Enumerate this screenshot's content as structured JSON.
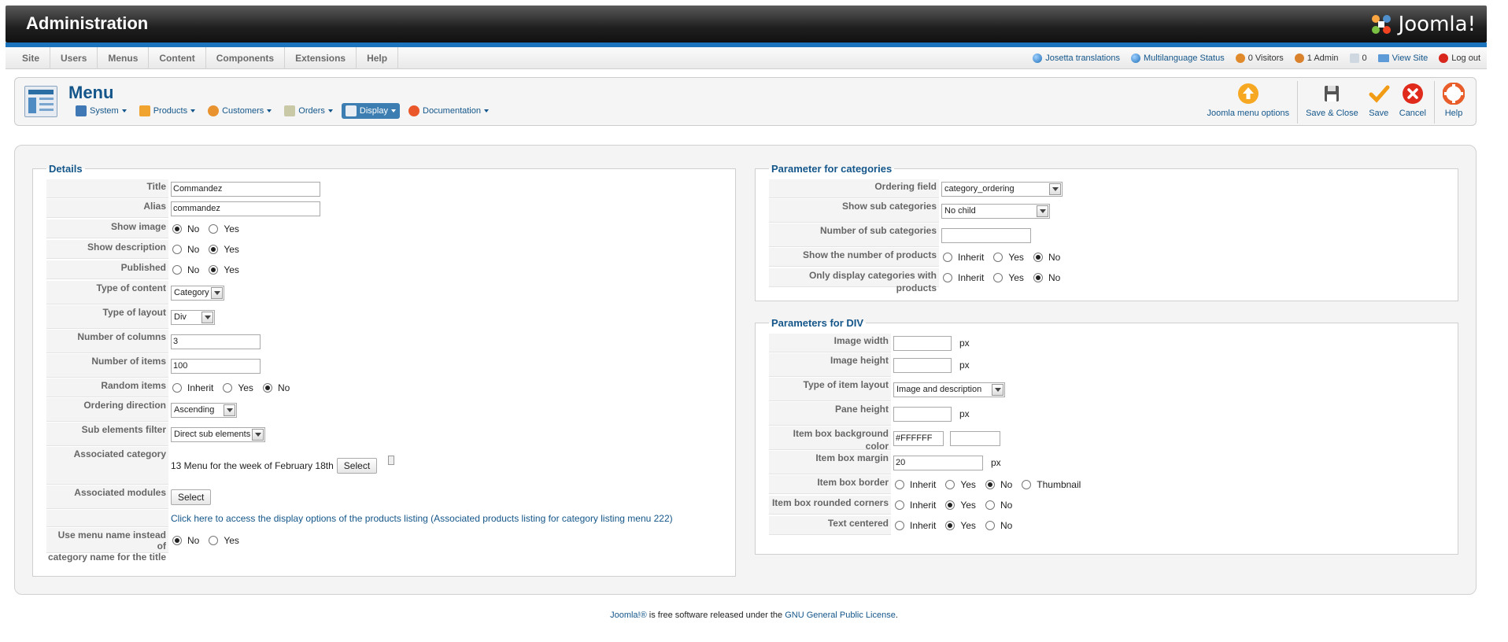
{
  "header": {
    "title": "Administration",
    "brand": "Joomla!"
  },
  "mainmenu": [
    "Site",
    "Users",
    "Menus",
    "Content",
    "Components",
    "Extensions",
    "Help"
  ],
  "status": [
    {
      "label": "Josetta translations",
      "icon": "globe-icon",
      "link": true
    },
    {
      "label": "Multilanguage Status",
      "icon": "globe-icon",
      "link": true
    },
    {
      "label": "0 Visitors",
      "icon": "users-icon",
      "link": false
    },
    {
      "label": "1 Admin",
      "icon": "user-icon",
      "link": false
    },
    {
      "label": "0",
      "icon": "message-icon",
      "link": false
    },
    {
      "label": "View Site",
      "icon": "monitor-icon",
      "link": true
    },
    {
      "label": "Log out",
      "icon": "logout-icon",
      "link": false
    }
  ],
  "toolbar": {
    "title": "Menu",
    "submenu": [
      "System",
      "Products",
      "Customers",
      "Orders",
      "Display",
      "Documentation"
    ],
    "actions": {
      "joomla_options": "Joomla menu options",
      "save_close": "Save & Close",
      "save": "Save",
      "cancel": "Cancel",
      "help": "Help"
    }
  },
  "details": {
    "legend": "Details",
    "labels": {
      "title": "Title",
      "alias": "Alias",
      "show_image": "Show image",
      "show_description": "Show description",
      "published": "Published",
      "type_content": "Type of content",
      "type_layout": "Type of layout",
      "num_columns": "Number of columns",
      "num_items": "Number of items",
      "random_items": "Random items",
      "ordering_direction": "Ordering direction",
      "sub_filter": "Sub elements filter",
      "assoc_category": "Associated category",
      "assoc_modules": "Associated modules",
      "use_menu_name_1": "Use menu name instead of",
      "use_menu_name_2": "category name for the title"
    },
    "values": {
      "title": "Commandez",
      "alias": "commandez",
      "type_content": "Category",
      "type_layout": "Div",
      "num_columns": "3",
      "num_items": "100",
      "ordering_direction": "Ascending",
      "sub_filter": "Direct sub elements",
      "assoc_category": "13 Menu for the week of February 18th",
      "select": "Select",
      "link": "Click here to access the display options of the products listing (Associated products listing for category listing menu 222)"
    },
    "options": {
      "no": "No",
      "yes": "Yes",
      "inherit": "Inherit"
    }
  },
  "categories": {
    "legend": "Parameter for categories",
    "labels": {
      "ordering_field": "Ordering field",
      "show_sub": "Show sub categories",
      "num_sub": "Number of sub categories",
      "show_num_products": "Show the number of products",
      "only_display": "Only display categories with products"
    },
    "values": {
      "ordering_field": "category_ordering",
      "show_sub": "No child",
      "num_sub": ""
    }
  },
  "div": {
    "legend": "Parameters for DIV",
    "labels": {
      "image_width": "Image width",
      "image_height": "Image height",
      "item_layout": "Type of item layout",
      "pane_height": "Pane height",
      "bg_color": "Item box background color",
      "margin": "Item box margin",
      "border": "Item box border",
      "rounded": "Item box rounded corners",
      "centered": "Text centered"
    },
    "values": {
      "px": "px",
      "item_layout": "Image and description",
      "bg_color": "#FFFFFF",
      "margin": "20",
      "thumbnail": "Thumbnail"
    }
  },
  "footer": {
    "joomla": "Joomla!®",
    "text": " is free software released under the ",
    "gpl": "GNU General Public License",
    "end": "."
  },
  "colors": {
    "accent": "#14568a",
    "strip": "#1c75bc"
  }
}
